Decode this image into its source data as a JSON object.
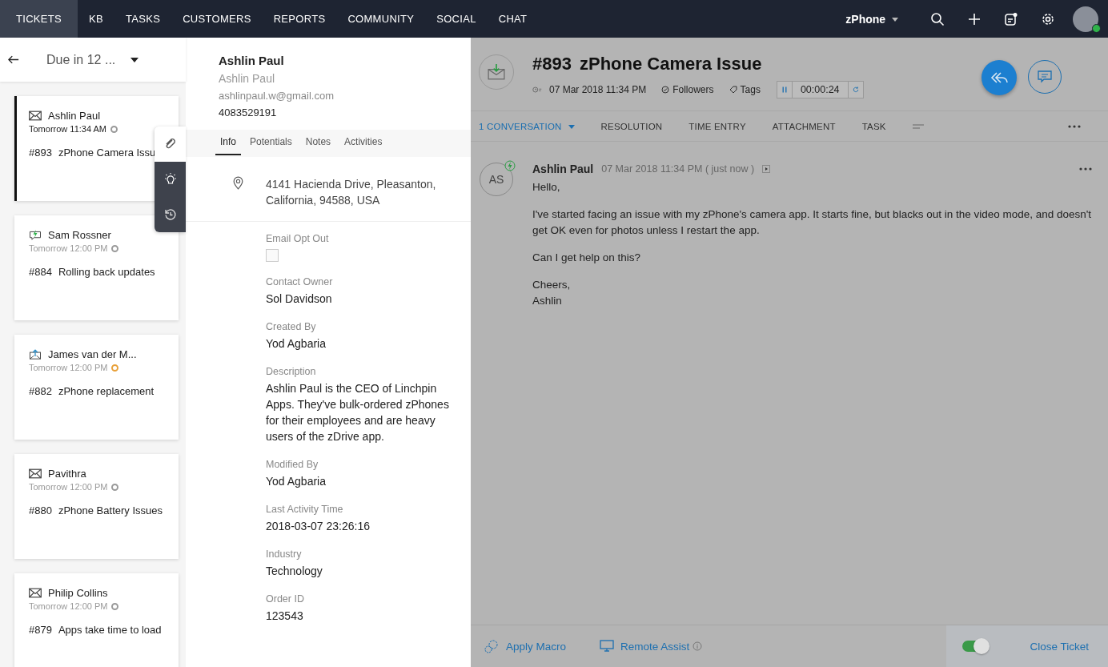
{
  "nav": {
    "items": [
      {
        "label": "TICKETS",
        "selected": true
      },
      {
        "label": "KB",
        "selected": false
      },
      {
        "label": "TASKS",
        "selected": false
      },
      {
        "label": "CUSTOMERS",
        "selected": false
      },
      {
        "label": "REPORTS",
        "selected": false
      },
      {
        "label": "COMMUNITY",
        "selected": false
      },
      {
        "label": "SOCIAL",
        "selected": false
      },
      {
        "label": "CHAT",
        "selected": false
      }
    ],
    "department": "zPhone"
  },
  "list": {
    "filter": "Due in 12 ...",
    "tickets": [
      {
        "kind": "email",
        "name": "Ashlin Paul",
        "due": "Tomorrow 11:34 AM",
        "color": "#9a9a9a",
        "number": "#893",
        "subject": "zPhone Camera Issu",
        "selected": true
      },
      {
        "kind": "chat",
        "name": "Sam Rossner",
        "due": "Tomorrow 12:00 PM",
        "color": "#9a9a9a",
        "number": "#884",
        "subject": "Rolling back updates",
        "selected": false
      },
      {
        "kind": "forward",
        "name": "James van der M...",
        "due": "Tomorrow 12:00 PM",
        "color": "#e8a13a",
        "number": "#882",
        "subject": "zPhone replacement",
        "selected": false
      },
      {
        "kind": "email",
        "name": "Pavithra",
        "due": "Tomorrow 12:00 PM",
        "color": "#9a9a9a",
        "number": "#880",
        "subject": "zPhone Battery Issues",
        "selected": false
      },
      {
        "kind": "email",
        "name": "Philip Collins",
        "due": "Tomorrow 12:00 PM",
        "color": "#9a9a9a",
        "number": "#879",
        "subject": "Apps take time to load",
        "selected": false
      }
    ]
  },
  "contact": {
    "name": "Ashlin Paul",
    "account": "Ashlin Paul",
    "email": "ashlinpaul.w@gmail.com",
    "phone": "4083529191",
    "tabs": [
      {
        "label": "Info",
        "selected": true
      },
      {
        "label": "Potentials",
        "selected": false
      },
      {
        "label": "Notes",
        "selected": false
      },
      {
        "label": "Activities",
        "selected": false
      }
    ],
    "address": "4141 Hacienda Drive, Pleasanton, California, 94588, USA",
    "fields": [
      {
        "kind": "checkbox",
        "label": "Email Opt Out",
        "checked": false
      },
      {
        "kind": "text",
        "label": "Contact Owner",
        "value": "Sol Davidson"
      },
      {
        "kind": "text",
        "label": "Created By",
        "value": "Yod Agbaria"
      },
      {
        "kind": "text",
        "label": "Description",
        "value": "Ashlin Paul is the CEO of Linchpin Apps. They've bulk-ordered zPhones for their employees and are heavy users of the zDrive app."
      },
      {
        "kind": "text",
        "label": "Modified By",
        "value": "Yod Agbaria"
      },
      {
        "kind": "text",
        "label": "Last Activity Time",
        "value": "2018-03-07 23:26:16"
      },
      {
        "kind": "text",
        "label": "Industry",
        "value": "Technology"
      },
      {
        "kind": "text",
        "label": "Order ID",
        "value": "123543"
      }
    ]
  },
  "ticket": {
    "number": "#893",
    "title": "zPhone Camera Issue",
    "created": "07 Mar 2018 11:34 PM",
    "followers": "Followers",
    "tags": "Tags",
    "timer": "00:00:24",
    "tabs": [
      {
        "label": "1 CONVERSATION",
        "selected": true
      },
      {
        "label": "RESOLUTION",
        "selected": false
      },
      {
        "label": "TIME ENTRY",
        "selected": false
      },
      {
        "label": "ATTACHMENT",
        "selected": false
      },
      {
        "label": "TASK",
        "selected": false
      }
    ],
    "message": {
      "initials": "AS",
      "author": "Ashlin Paul",
      "time": "07 Mar 2018 11:34 PM ( just now )",
      "paragraphs": [
        "Hello,",
        "I've started facing an issue with my zPhone's camera app. It starts fine, but blacks out in the video mode, and doesn't get OK even for photos unless I restart the app.",
        "Can I get help on this?",
        "Cheers,\nAshlin"
      ]
    },
    "footer": {
      "macro": "Apply Macro",
      "remote": "Remote Assist",
      "toggle_on": true,
      "close": "Close Ticket"
    }
  }
}
